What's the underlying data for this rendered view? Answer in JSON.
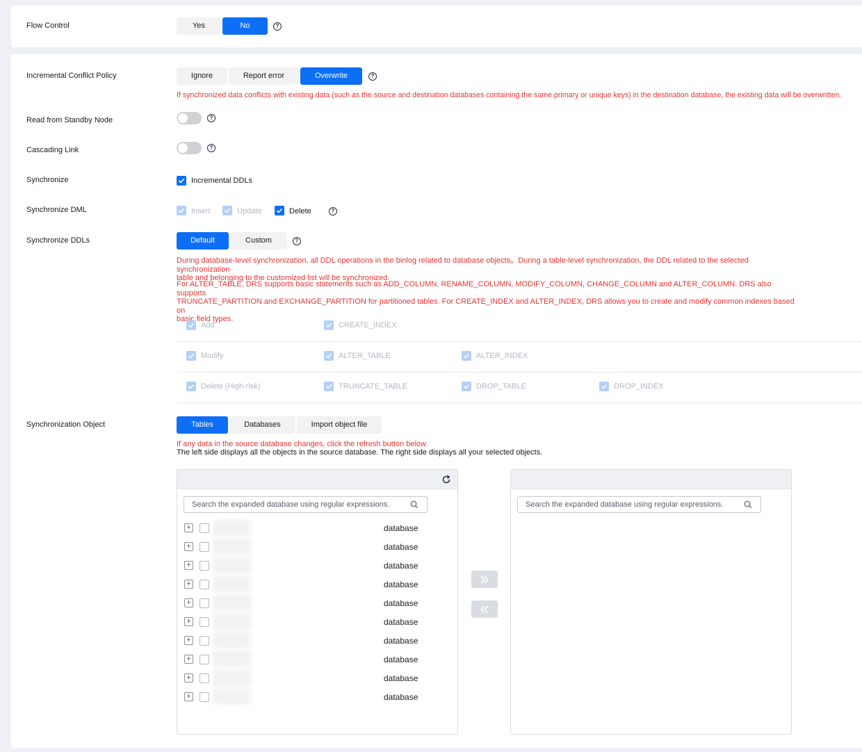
{
  "flow_control": {
    "label": "Flow Control",
    "options": [
      "Yes",
      "No"
    ],
    "selected": "No",
    "help_icon": "help-icon"
  },
  "conflict_policy": {
    "label": "Incremental Conflict Policy",
    "options": [
      "Ignore",
      "Report error",
      "Overwrite"
    ],
    "selected": "Overwrite",
    "note": "If synchronized data conflicts with existing data (such as the source and destination databases containing the same primary or unique keys) in the destination database, the existing data will be overwritten."
  },
  "standby": {
    "label": "Read from Standby Node",
    "enabled": false
  },
  "cascading": {
    "label": "Cascading Link",
    "enabled": false
  },
  "synchronize": {
    "label": "Synchronize",
    "option": "Incremental DDLs",
    "checked": true
  },
  "sync_dml": {
    "label": "Synchronize DML",
    "options": [
      {
        "label": "Insert",
        "checked": true,
        "disabled": true
      },
      {
        "label": "Update",
        "checked": true,
        "disabled": true
      },
      {
        "label": "Delete",
        "checked": true,
        "disabled": false
      }
    ]
  },
  "sync_ddls": {
    "label": "Synchronize DDLs",
    "options": [
      "Default",
      "Custom"
    ],
    "selected": "Default",
    "note1_line1": "During database-level synchronization, all DDL operations in the binlog related to database objects。During a table-level synchronization, the DDL related to the selected synchronization",
    "note1_line2": "table and belonging to the customized list will be synchronized.",
    "note2_line1": "For ALTER_TABLE, DRS supports basic statements such as ADD_COLUMN, RENAME_COLUMN, MODIFY_COLUMN, CHANGE_COLUMN and ALTER_COLUMN. DRS also supports",
    "note2_line2": "TRUNCATE_PARTITION and EXCHANGE_PARTITION for partitioned tables. For CREATE_INDEX and ALTER_INDEX, DRS allows you to create and modify common indexes based on",
    "note2_line3": "basic field types.",
    "rows": [
      [
        "Add",
        "CREATE_INDEX"
      ],
      [
        "Modify",
        "ALTER_TABLE",
        "ALTER_INDEX"
      ],
      [
        "Delete (High-risk)",
        "TRUNCATE_TABLE",
        "DROP_TABLE",
        "DROP_INDEX"
      ]
    ]
  },
  "sync_object": {
    "label": "Synchronization Object",
    "options": [
      "Tables",
      "Databases",
      "Import object file"
    ],
    "selected": "Tables",
    "note_red": "If any data in the source database changes, click the refresh button below.",
    "note_black": "The left side displays all the objects in the source database. The right side displays all your selected objects.",
    "left_search_placeholder": "Search the expanded database using regular expressions.",
    "right_search_placeholder": "Search the expanded database using regular expressions.",
    "items": [
      {
        "type": "database"
      },
      {
        "type": "database"
      },
      {
        "type": "database"
      },
      {
        "type": "database"
      },
      {
        "type": "database"
      },
      {
        "type": "database"
      },
      {
        "type": "database"
      },
      {
        "type": "database"
      },
      {
        "type": "database"
      },
      {
        "type": "database"
      }
    ]
  },
  "colors": {
    "primary": "#0d6ef6",
    "danger": "#e53333",
    "disabled_check": "#b3d0f8"
  }
}
